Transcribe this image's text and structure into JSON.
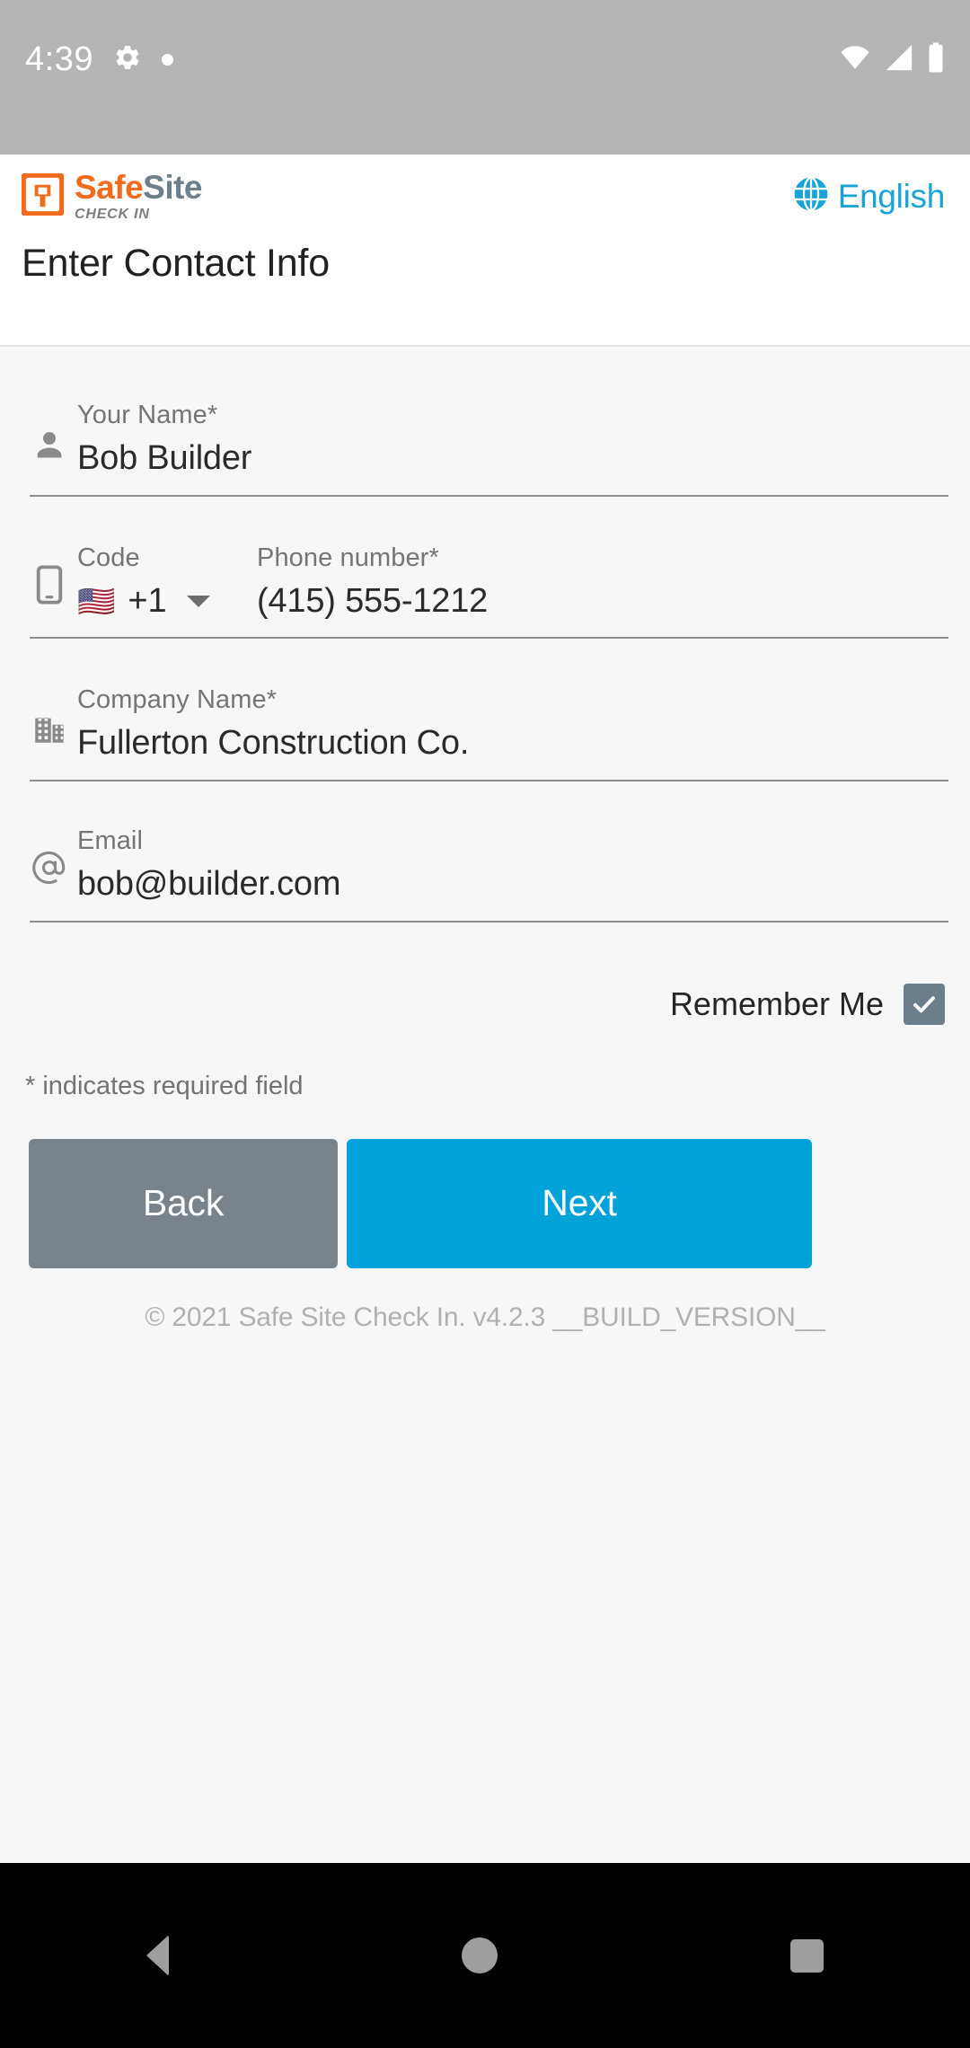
{
  "status_bar": {
    "time": "4:39",
    "icons": [
      "gear-icon",
      "notification-dot",
      "wifi-icon",
      "cellular-signal-icon",
      "battery-icon"
    ]
  },
  "header": {
    "logo": {
      "mark": "safesite-logo-icon",
      "word_primary": "Safe",
      "word_secondary": "Site",
      "tagline": "CHECK IN",
      "color_primary": "#f26a1b",
      "color_secondary": "#6d7f8b"
    },
    "language_button": {
      "icon": "globe-icon",
      "label": "English",
      "color": "#18a5d6"
    },
    "page_title": "Enter Contact Info"
  },
  "form": {
    "fields": [
      {
        "icon": "person-icon",
        "label": "Your Name*",
        "value": "Bob Builder",
        "placeholder": "Your Name"
      },
      {
        "icon": "smartphone-icon",
        "code_label": "Code",
        "code_flag": "🇺🇸",
        "code_value": "+1",
        "label": "Phone number*",
        "value": "(415) 555-1212",
        "placeholder": "Phone number"
      },
      {
        "icon": "building-icon",
        "label": "Company Name*",
        "value": "Fullerton Construction Co.",
        "placeholder": "Company Name"
      },
      {
        "icon": "at-sign-icon",
        "label": "Email",
        "value": "bob@builder.com",
        "placeholder": "Email"
      }
    ],
    "remember_me": {
      "label": "Remember Me",
      "checked": true,
      "check_color": "#6d7f8b"
    },
    "required_note": "* indicates required field"
  },
  "actions": {
    "back_label": "Back",
    "back_color": "#78838c",
    "next_label": "Next",
    "next_color": "#00a3d9"
  },
  "footer": {
    "copyright": "© 2021 Safe Site Check In. v4.2.3 __BUILD_VERSION__"
  },
  "nav_bar": {
    "back": "back-triangle-icon",
    "home": "home-circle-icon",
    "recents": "recents-square-icon"
  }
}
